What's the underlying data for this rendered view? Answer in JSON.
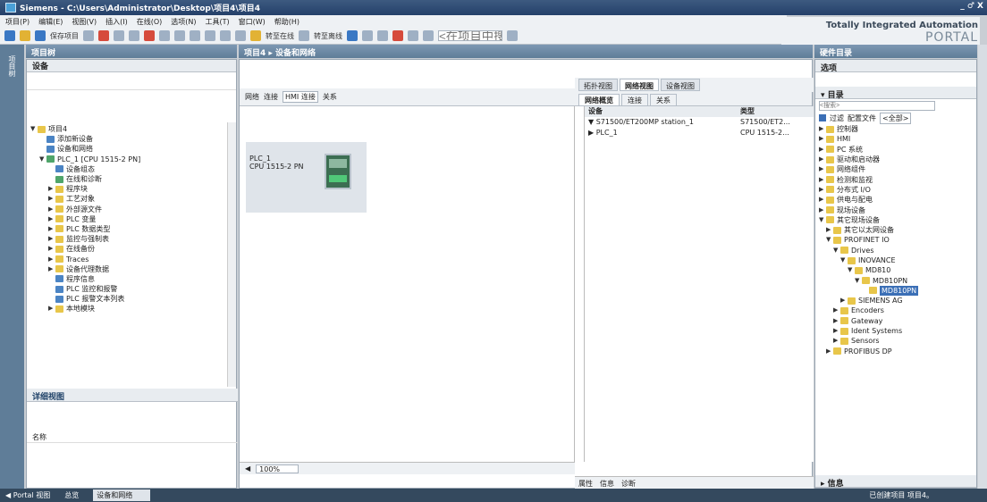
{
  "window": {
    "title": "Siemens  -  C:\\Users\\Administrator\\Desktop\\项目4\\项目4",
    "controls": "_ ♂ X"
  },
  "menu": [
    "项目(P)",
    "编辑(E)",
    "视图(V)",
    "插入(I)",
    "在线(O)",
    "选项(N)",
    "工具(T)",
    "窗口(W)",
    "帮助(H)"
  ],
  "toolbar": {
    "save_label": "保存项目",
    "go_online": "转至在线",
    "go_offline": "转至离线",
    "search_placeholder": "<在项目中搜索>"
  },
  "brand": {
    "line1": "Totally Integrated Automation",
    "line2": "PORTAL"
  },
  "sidestrip": {
    "label": "项目树"
  },
  "project_tree": {
    "header": "项目树",
    "devices_tab": "设备",
    "items": [
      {
        "label": "项目4",
        "level": 0,
        "arrow": "▼",
        "icon": "f"
      },
      {
        "label": "添加新设备",
        "level": 1,
        "arrow": "",
        "icon": "b"
      },
      {
        "label": "设备和网络",
        "level": 1,
        "arrow": "",
        "icon": "b"
      },
      {
        "label": "PLC_1 [CPU 1515-2 PN]",
        "level": 1,
        "arrow": "▼",
        "icon": "g"
      },
      {
        "label": "设备组态",
        "level": 2,
        "arrow": "",
        "icon": "b"
      },
      {
        "label": "在线和诊断",
        "level": 2,
        "arrow": "",
        "icon": "g"
      },
      {
        "label": "程序块",
        "level": 2,
        "arrow": "▶",
        "icon": "f"
      },
      {
        "label": "工艺对象",
        "level": 2,
        "arrow": "▶",
        "icon": "f"
      },
      {
        "label": "外部源文件",
        "level": 2,
        "arrow": "▶",
        "icon": "f"
      },
      {
        "label": "PLC 变量",
        "level": 2,
        "arrow": "▶",
        "icon": "f"
      },
      {
        "label": "PLC 数据类型",
        "level": 2,
        "arrow": "▶",
        "icon": "f"
      },
      {
        "label": "监控与强制表",
        "level": 2,
        "arrow": "▶",
        "icon": "f"
      },
      {
        "label": "在线备份",
        "level": 2,
        "arrow": "▶",
        "icon": "f"
      },
      {
        "label": "Traces",
        "level": 2,
        "arrow": "▶",
        "icon": "f"
      },
      {
        "label": "设备代理数据",
        "level": 2,
        "arrow": "▶",
        "icon": "f"
      },
      {
        "label": "程序信息",
        "level": 2,
        "arrow": "",
        "icon": "b"
      },
      {
        "label": "PLC 监控和报警",
        "level": 2,
        "arrow": "",
        "icon": "b"
      },
      {
        "label": "PLC 报警文本列表",
        "level": 2,
        "arrow": "",
        "icon": "b"
      },
      {
        "label": "本地模块",
        "level": 2,
        "arrow": "▶",
        "icon": "f"
      }
    ],
    "detail_header": "详细视图",
    "detail_col": "名称"
  },
  "center": {
    "header": "项目4 ▸ 设备和网络",
    "tool_network": "网络",
    "tool_connect": "连接",
    "tool_hmi": "HMI 连接",
    "tool_relation": "关系",
    "zoom": "100%",
    "plc_name": "PLC_1",
    "plc_cpu": "CPU 1515-2 PN",
    "view_tabs": [
      "拓扑视图",
      "网络视图",
      "设备视图"
    ],
    "ov_tabs": [
      "网络概览",
      "连接",
      "关系"
    ],
    "ov_cols": [
      "设备",
      "类型"
    ],
    "ov_rows": [
      {
        "name": "▼ S71500/ET200MP station_1",
        "type": "S71500/ET2..."
      },
      {
        "name": "  ▶ PLC_1",
        "type": "CPU 1515-2..."
      }
    ],
    "info_tabs": [
      "属性",
      "信息",
      "诊断"
    ]
  },
  "catalog": {
    "header": "硬件目录",
    "options": "选项",
    "catalog_label": "目录",
    "search_placeholder": "<搜索>",
    "filter": "过滤",
    "profile": "配置文件",
    "profile_val": "<全部>",
    "items": [
      {
        "label": "控制器",
        "level": 0,
        "arrow": "▶"
      },
      {
        "label": "HMI",
        "level": 0,
        "arrow": "▶"
      },
      {
        "label": "PC 系统",
        "level": 0,
        "arrow": "▶"
      },
      {
        "label": "驱动和启动器",
        "level": 0,
        "arrow": "▶"
      },
      {
        "label": "网络组件",
        "level": 0,
        "arrow": "▶"
      },
      {
        "label": "检测和监视",
        "level": 0,
        "arrow": "▶"
      },
      {
        "label": "分布式 I/O",
        "level": 0,
        "arrow": "▶"
      },
      {
        "label": "供电与配电",
        "level": 0,
        "arrow": "▶"
      },
      {
        "label": "现场设备",
        "level": 0,
        "arrow": "▶"
      },
      {
        "label": "其它现场设备",
        "level": 0,
        "arrow": "▼"
      },
      {
        "label": "其它以太网设备",
        "level": 1,
        "arrow": "▶"
      },
      {
        "label": "PROFINET IO",
        "level": 1,
        "arrow": "▼"
      },
      {
        "label": "Drives",
        "level": 2,
        "arrow": "▼"
      },
      {
        "label": "INOVANCE",
        "level": 3,
        "arrow": "▼"
      },
      {
        "label": "MD810",
        "level": 4,
        "arrow": "▼"
      },
      {
        "label": "MD810PN",
        "level": 5,
        "arrow": "▼"
      },
      {
        "label": "MD810PN",
        "level": 6,
        "arrow": "",
        "selected": true
      },
      {
        "label": "SIEMENS AG",
        "level": 3,
        "arrow": "▶"
      },
      {
        "label": "Encoders",
        "level": 2,
        "arrow": "▶"
      },
      {
        "label": "Gateway",
        "level": 2,
        "arrow": "▶"
      },
      {
        "label": "Ident Systems",
        "level": 2,
        "arrow": "▶"
      },
      {
        "label": "Sensors",
        "level": 2,
        "arrow": "▶"
      },
      {
        "label": "PROFIBUS DP",
        "level": 1,
        "arrow": "▶"
      }
    ],
    "info_label": "信息"
  },
  "statusbar": {
    "portal": "◀ Portal 视图",
    "overview": "总览",
    "task": "设备和网络",
    "status": "已创建项目 项目4。"
  }
}
